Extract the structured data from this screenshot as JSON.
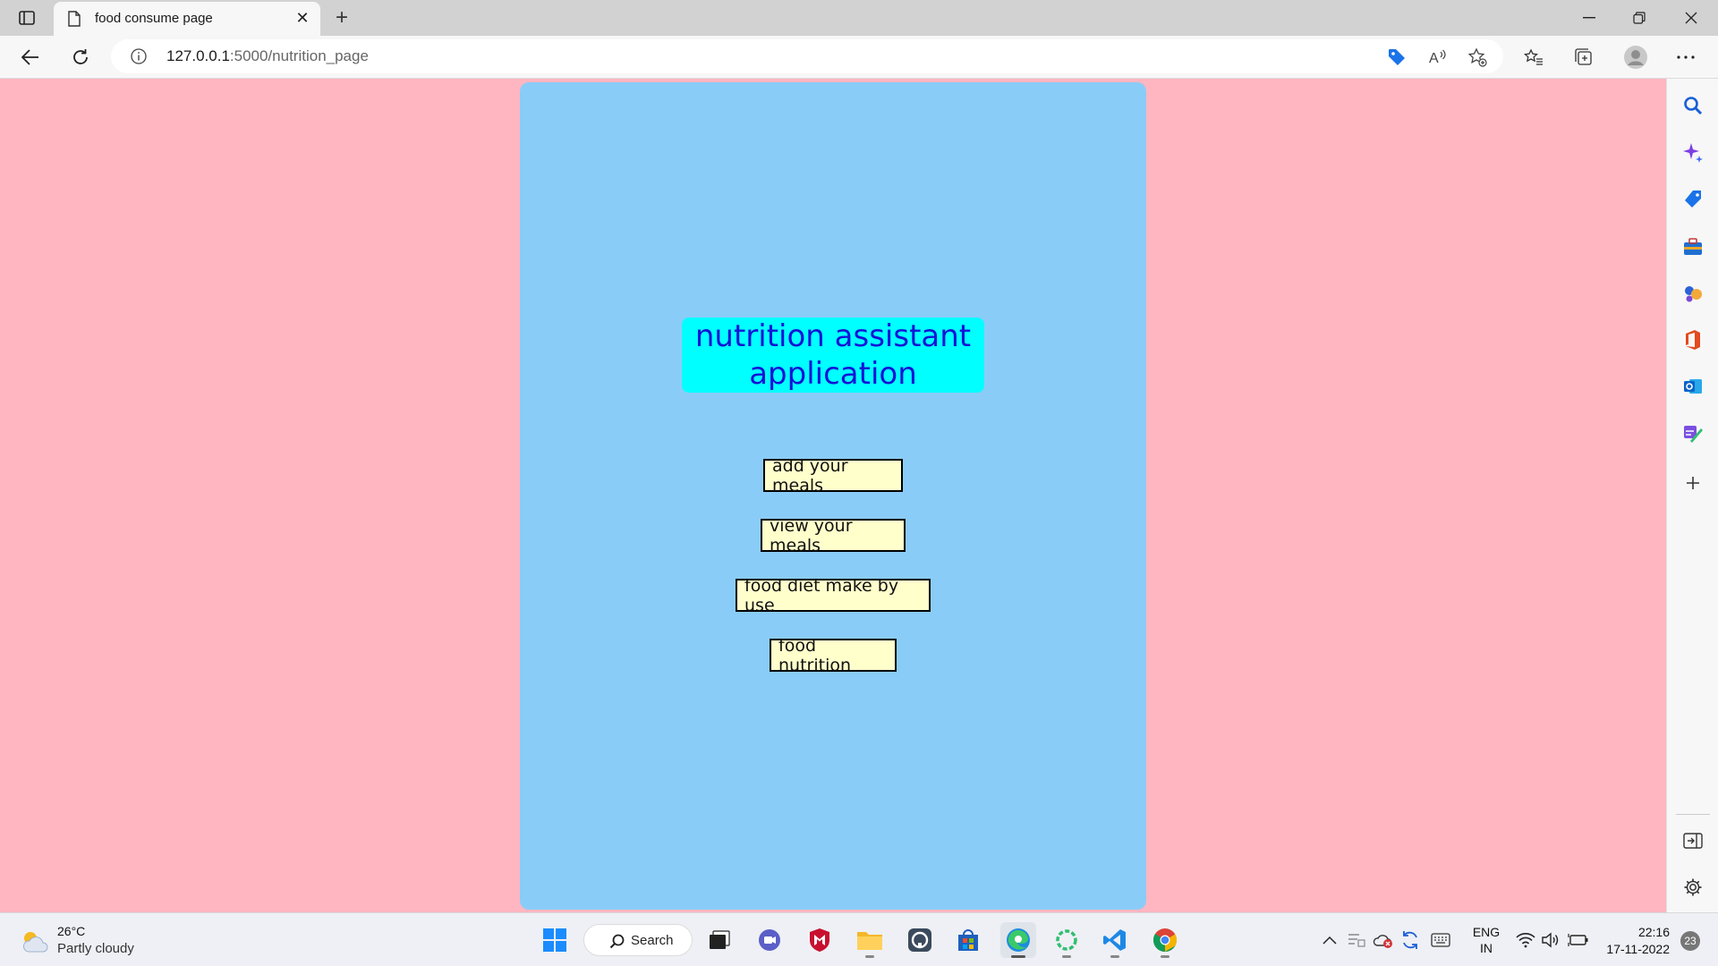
{
  "browser": {
    "tab": {
      "title": "food consume page"
    },
    "address": {
      "host": "127.0.0.1",
      "path": ":5000/nutrition_page"
    }
  },
  "page": {
    "heading": "nutrition assistant application",
    "buttons": [
      {
        "label": "add your meals"
      },
      {
        "label": "view your meals"
      },
      {
        "label": "food diet make by use"
      },
      {
        "label": "food nutrition"
      }
    ],
    "colors": {
      "page_background": "#ffb6c1",
      "panel_background": "#8accf8",
      "heading_background": "#00ffff",
      "heading_text": "#1414d6",
      "button_background": "#ffffcc"
    }
  },
  "taskbar": {
    "weather": {
      "temp": "26°C",
      "condition": "Partly cloudy"
    },
    "search_label": "Search",
    "language": {
      "line1": "ENG",
      "line2": "IN"
    },
    "clock": {
      "time": "22:16",
      "date": "17-11-2022"
    },
    "notification_count": "23"
  }
}
